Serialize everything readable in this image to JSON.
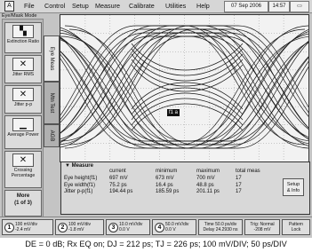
{
  "menu": {
    "app_icon": "A",
    "items": [
      "File",
      "Control",
      "Setup",
      "Measure",
      "Calibrate",
      "Utilities",
      "Help"
    ],
    "date": "07 Sep 2006",
    "time": "14:57",
    "mode_label": "Eye/Mask Mode"
  },
  "toolbar": {
    "buttons": [
      {
        "label": "Extinction Ratio",
        "icon_glyph": "▚"
      },
      {
        "label": "Jitter RMS",
        "icon_glyph": "✕"
      },
      {
        "label": "Jitter p-p",
        "icon_glyph": "✕"
      },
      {
        "label": "Average Power",
        "icon_glyph": "▁"
      },
      {
        "label": "Crossing Percentage",
        "icon_glyph": "✕"
      }
    ],
    "more_line1": "More",
    "more_line2": "(1 of 3)"
  },
  "tabs": [
    "Eye Meas",
    "Mtn Test",
    "AGB"
  ],
  "plot": {
    "marker": "f1 a"
  },
  "measurements": {
    "tab_label": "Measure",
    "headers": [
      "current",
      "minimum",
      "maximum",
      "total meas"
    ],
    "rows": [
      {
        "name": "Eye height(f1)",
        "current": "697 mV",
        "minimum": "673 mV",
        "maximum": "700 mV",
        "total": "17"
      },
      {
        "name": "Eye width(f1)",
        "current": "75.2 ps",
        "minimum": "16.4 ps",
        "maximum": "48.8 ps",
        "total": "17"
      },
      {
        "name": "Jitter p-p(f1)",
        "current": "194.44 ps",
        "minimum": "185.59 ps",
        "maximum": "201.11 ps",
        "total": "17"
      }
    ],
    "setup_line1": "Setup",
    "setup_line2": "& Info"
  },
  "status": {
    "ch1": {
      "num": "1",
      "line1": "100 mV/div",
      "line2": "-2.4 mV"
    },
    "ch2": {
      "num": "2",
      "line1": "100 mV/div",
      "line2": "-1.8 mV"
    },
    "ch3": {
      "num": "3",
      "line1": "10.0 mV/div",
      "line2": "0.0 V"
    },
    "ch4": {
      "num": "4",
      "line1": "50.0 mV/div",
      "line2": "0.0 V"
    },
    "time": {
      "line1": "Time 50.0 ps/div",
      "line2": "Delay 24.2930 ns"
    },
    "trig": {
      "line1": "Trig: Normal",
      "line2": "-208 mV"
    },
    "pattern": {
      "line1": "Pattern",
      "line2": "Lock"
    }
  },
  "caption": "DE = 0 dB; Rx EQ on; DJ = 212 ps; TJ = 226 ps; 100 mV/DIV; 50 ps/DIV"
}
